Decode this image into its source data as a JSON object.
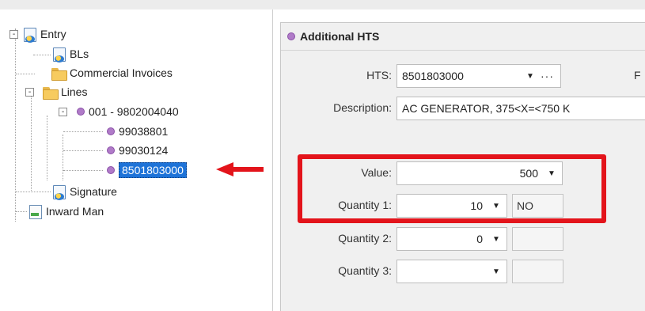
{
  "tree": {
    "nodes": [
      {
        "label": "Entry",
        "icon": "entry-doc-icon",
        "expander": "-"
      },
      {
        "label": "BLs",
        "icon": "document-icon"
      },
      {
        "label": "Commercial Invoices",
        "icon": "folder-icon"
      },
      {
        "label": "Lines",
        "icon": "folder-icon",
        "expander": "-"
      },
      {
        "label": "001 - 9802004040",
        "icon": "purple-dot-icon",
        "expander": "-"
      },
      {
        "label": "99038801",
        "icon": "purple-dot-icon"
      },
      {
        "label": "99030124",
        "icon": "purple-dot-icon"
      },
      {
        "label": "8501803000",
        "icon": "purple-dot-icon",
        "selected": true
      },
      {
        "label": "Signature",
        "icon": "document-icon"
      },
      {
        "label": "Inward Man",
        "icon": "page-icon"
      }
    ]
  },
  "panel": {
    "title": "Additional HTS",
    "cut_label": "F",
    "hts": {
      "label": "HTS:",
      "value": "8501803000"
    },
    "description": {
      "label": "Description:",
      "value": "AC GENERATOR, 375<X=<750 K"
    },
    "value_field": {
      "label": "Value:",
      "value": "500"
    },
    "quantity1": {
      "label": "Quantity 1:",
      "value": "10",
      "unit": "NO"
    },
    "quantity2": {
      "label": "Quantity 2:",
      "value": "0",
      "unit": ""
    },
    "quantity3": {
      "label": "Quantity 3:",
      "value": "",
      "unit": ""
    }
  },
  "colors": {
    "highlight": "#e3141b",
    "selection": "#1e73d8",
    "dot": "#b07bc8"
  }
}
